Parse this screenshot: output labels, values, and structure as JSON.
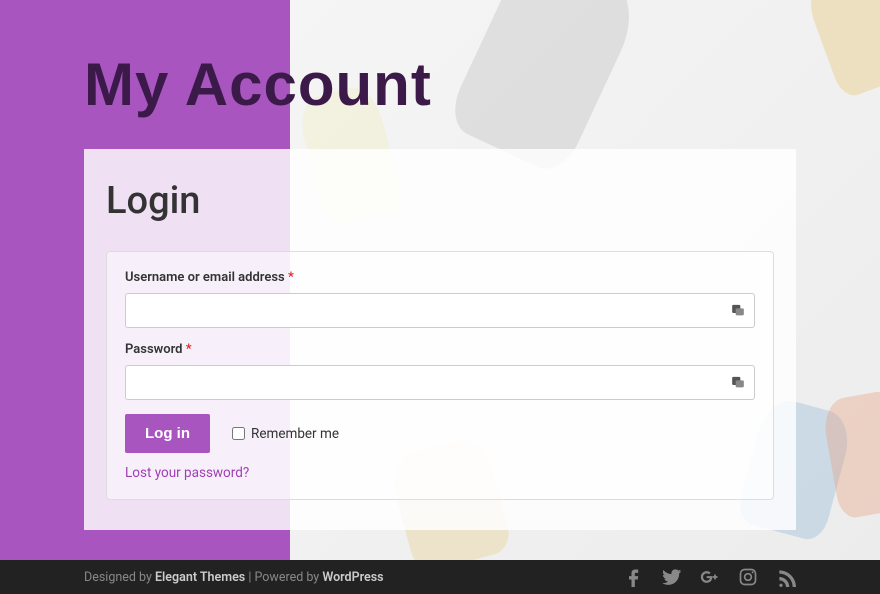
{
  "page": {
    "title": "My Account",
    "login_heading": "Login"
  },
  "form": {
    "username_label": "Username or email address ",
    "password_label": "Password ",
    "required_mark": "*",
    "username_value": "",
    "password_value": "",
    "login_button": "Log in",
    "remember_label": "Remember me",
    "lost_password": "Lost your password?"
  },
  "footer": {
    "designed_by": "Designed by ",
    "designer": "Elegant Themes",
    "separator": " | Powered by ",
    "platform": "WordPress"
  }
}
